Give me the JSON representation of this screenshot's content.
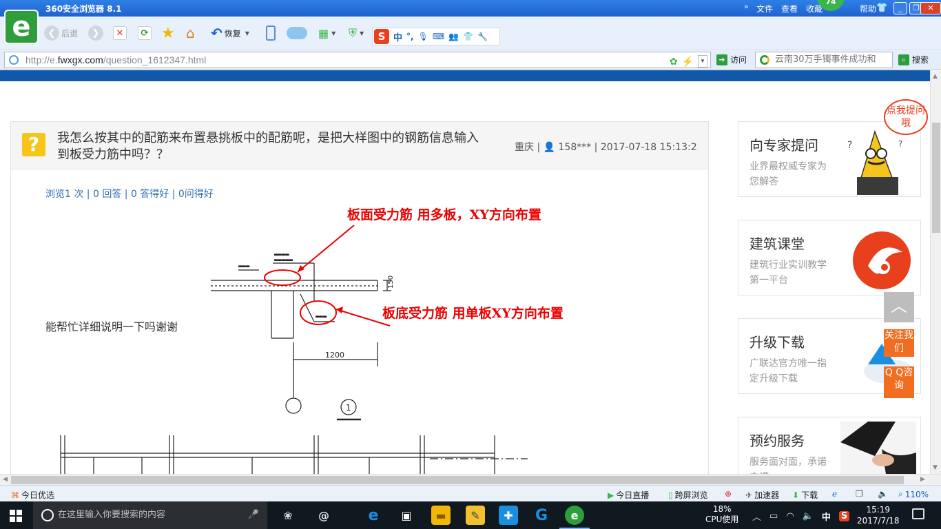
{
  "browser": {
    "title": "360安全浏览器 8.1",
    "menu": [
      "文件",
      "查看",
      "收藏",
      "帮助"
    ],
    "badge": "74",
    "toolbar": {
      "back": "后退",
      "restore": "恢复"
    },
    "ime": {
      "zh": "中",
      "punct": "°,"
    },
    "address": {
      "scheme": "http://e.",
      "domain": "fwxgx.com",
      "path": "/question_1612347.html"
    },
    "go_label": "访问",
    "search_text": "云南30万手镯事件成功和",
    "search_label": "搜索"
  },
  "question": {
    "title": "我怎么按其中的配筋来布置悬挑板中的配筋呢，是把大样图中的钢筋信息输入到板受力筋中吗？？",
    "meta": "重庆 | 👤 158*** | 2017-07-18 15:13:23",
    "stats": "浏览1 次 | 0 回答 | 0 答得好 | 0问得好",
    "body": "能帮忙详细说明一下吗谢谢",
    "annotation_top": "板面受力筋 用多板，XY方向布置",
    "annotation_bottom": "板底受力筋 用单板XY方向布置",
    "drawing_dimension": "1200",
    "drawing_section": "1",
    "drawing_thickness": "150"
  },
  "sidebar": [
    {
      "title": "向专家提问",
      "desc": "业界最权威专家为您解答"
    },
    {
      "title": "建筑课堂",
      "desc": "建筑行业实训教学第一平台"
    },
    {
      "title": "升级下载",
      "desc": "广联达官方唯一指定升级下载"
    },
    {
      "title": "预约服务",
      "desc": "服务面对面，承诺之诺"
    }
  ],
  "bubble": "点我提问哦",
  "float": {
    "follow": "关注我们",
    "qq": "Q Q咨询"
  },
  "statusbar": {
    "today": "今日优选",
    "live": "今日直播",
    "cross": "跨屏浏览",
    "accel": "加速器",
    "download": "下载",
    "zoom": "110%"
  },
  "taskbar": {
    "search_placeholder": "在这里输入你要搜索的内容",
    "cpu_pct": "18%",
    "cpu_label": "CPU使用",
    "ime": "中",
    "time": "15:19",
    "date": "2017/7/18"
  },
  "colors": {
    "accent_blue": "#1158a9",
    "annotation_red": "#e00000",
    "float_orange": "#f26d1f",
    "question_yellow": "#f6c518"
  }
}
